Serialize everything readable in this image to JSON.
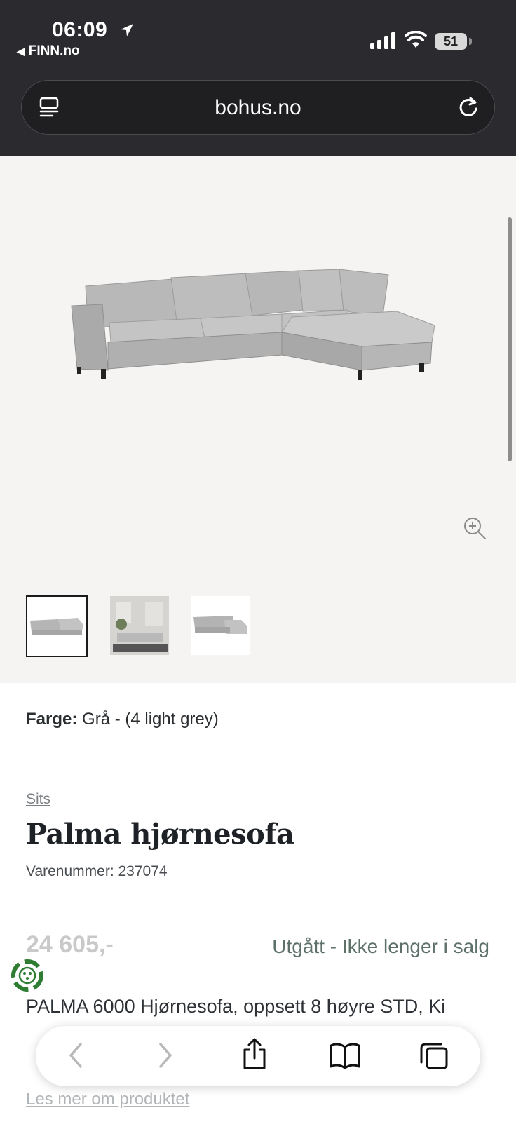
{
  "status_bar": {
    "time": "06:09",
    "back_app": "FINN.no",
    "battery": "51"
  },
  "browser": {
    "url": "bohus.no"
  },
  "gallery": {
    "thumbnails": [
      "sofa-front",
      "living-room",
      "sofa-angle"
    ]
  },
  "product": {
    "color_label": "Farge:",
    "color_value": "Grå - (4 light grey)",
    "breadcrumb": "Sits",
    "title": "Palma hjørnesofa",
    "sku": "Varenummer: 237074",
    "price": "24 605,-",
    "status": "Utgått - Ikke lenger i salg",
    "description": "PALMA 6000 Hjørnesofa, oppsett 8 høyre STD, Ki",
    "read_more": "Les mer om produktet"
  },
  "colors": {
    "header_bg": "#2b2b2f",
    "status_green": "#5d7169",
    "eco_green": "#2e7d32"
  }
}
